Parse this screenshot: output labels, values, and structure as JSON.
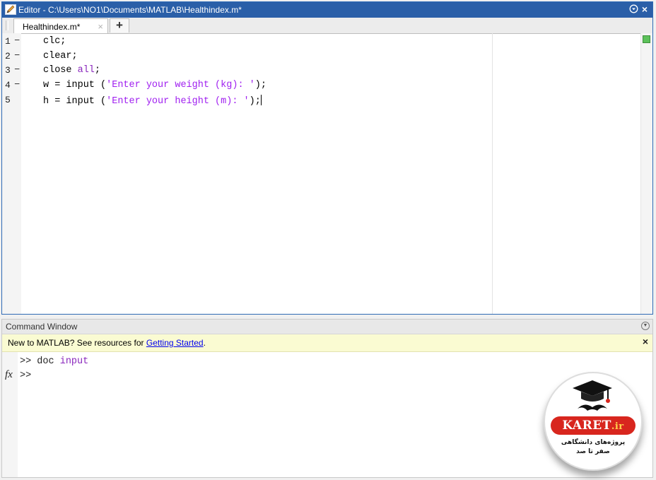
{
  "editor": {
    "title": "Editor - C:\\Users\\NO1\\Documents\\MATLAB\\Healthindex.m*",
    "tab_label": "Healthindex.m*",
    "tab_close": "×",
    "add_tab": "+",
    "menu_icon": "options-circle-icon",
    "close": "×",
    "lines": [
      {
        "num": "1",
        "mark": "−",
        "parts": [
          {
            "t": "clc;",
            "c": "plain"
          }
        ]
      },
      {
        "num": "2",
        "mark": "−",
        "parts": [
          {
            "t": "clear;",
            "c": "plain"
          }
        ]
      },
      {
        "num": "3",
        "mark": "−",
        "parts": [
          {
            "t": "close ",
            "c": "plain"
          },
          {
            "t": "all",
            "c": "kw"
          },
          {
            "t": ";",
            "c": "plain"
          }
        ]
      },
      {
        "num": "4",
        "mark": "−",
        "parts": [
          {
            "t": "w = input (",
            "c": "plain"
          },
          {
            "t": "'Enter your weight (kg): '",
            "c": "str"
          },
          {
            "t": ");",
            "c": "plain"
          }
        ]
      },
      {
        "num": "5",
        "mark": "",
        "parts": [
          {
            "t": "h = input (",
            "c": "plain"
          },
          {
            "t": "'Enter your height (m): '",
            "c": "str"
          },
          {
            "t": ");",
            "c": "plain"
          }
        ]
      }
    ]
  },
  "command_window": {
    "title": "Command Window",
    "notice_prefix": "New to MATLAB? See resources for ",
    "notice_link": "Getting Started",
    "notice_suffix": ".",
    "notice_close": "×",
    "history_prompt": ">> doc ",
    "history_arg": "input",
    "prompt": ">>",
    "fx": "fx"
  },
  "watermark": {
    "brand": "KARET",
    "tld": ".ir",
    "line1": "پروژه‌های دانشگاهی",
    "line2": "صفر تا صد",
    "colors": {
      "brand_bg": "#d8261e",
      "tld": "#ffd24d"
    }
  }
}
